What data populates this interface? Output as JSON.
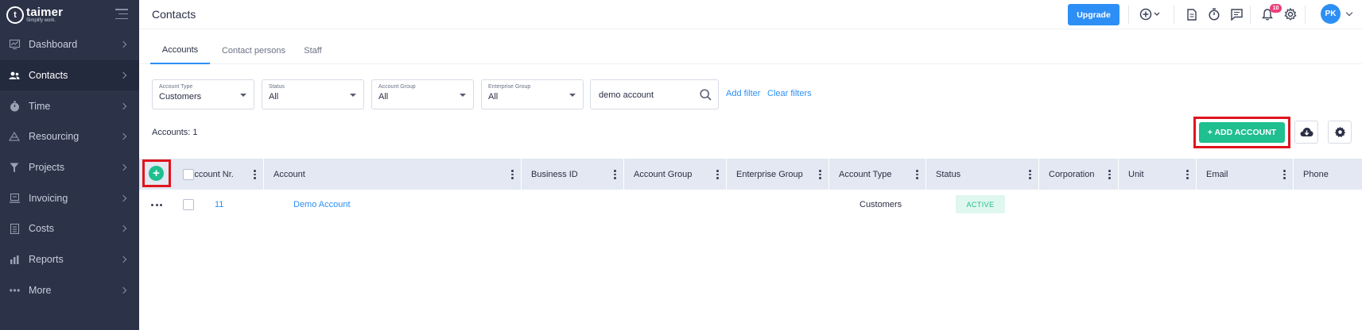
{
  "app": {
    "name": "taimer",
    "slogan": "Simplify work."
  },
  "sidebar": {
    "items": [
      {
        "label": "Dashboard",
        "icon": "dashboard-icon"
      },
      {
        "label": "Contacts",
        "icon": "contacts-icon",
        "active": true
      },
      {
        "label": "Time",
        "icon": "time-icon"
      },
      {
        "label": "Resourcing",
        "icon": "resourcing-icon"
      },
      {
        "label": "Projects",
        "icon": "projects-icon"
      },
      {
        "label": "Invoicing",
        "icon": "invoicing-icon"
      },
      {
        "label": "Costs",
        "icon": "costs-icon"
      },
      {
        "label": "Reports",
        "icon": "reports-icon"
      },
      {
        "label": "More",
        "icon": "more-icon"
      }
    ]
  },
  "header": {
    "title": "Contacts",
    "upgrade_label": "Upgrade",
    "notification_count": "10",
    "avatar_initials": "PK"
  },
  "tabs": [
    {
      "label": "Accounts",
      "active": true
    },
    {
      "label": "Contact persons"
    },
    {
      "label": "Staff"
    }
  ],
  "filters": [
    {
      "label": "Account Type",
      "value": "Customers"
    },
    {
      "label": "Status",
      "value": "All"
    },
    {
      "label": "Account Group",
      "value": "All"
    },
    {
      "label": "Enterprise Group",
      "value": "All"
    }
  ],
  "search": {
    "value": "demo account"
  },
  "filter_links": {
    "add": "Add filter",
    "clear": "Clear filters"
  },
  "summary": {
    "count_text": "Accounts: 1"
  },
  "actions": {
    "add_account_label": "+ ADD ACCOUNT"
  },
  "table": {
    "columns": [
      "Account Nr.",
      "Account",
      "Business ID",
      "Account Group",
      "Enterprise Group",
      "Account Type",
      "Status",
      "Corporation",
      "Unit",
      "Email",
      "Phone"
    ],
    "rows": [
      {
        "account_nr": "11",
        "account": "Demo Account",
        "account_type": "Customers",
        "status": "ACTIVE"
      }
    ]
  },
  "colors": {
    "accent": "#2d8ff5",
    "success": "#1fbf8f",
    "sidebar": "#2c3348",
    "highlight": "#e0141e"
  }
}
